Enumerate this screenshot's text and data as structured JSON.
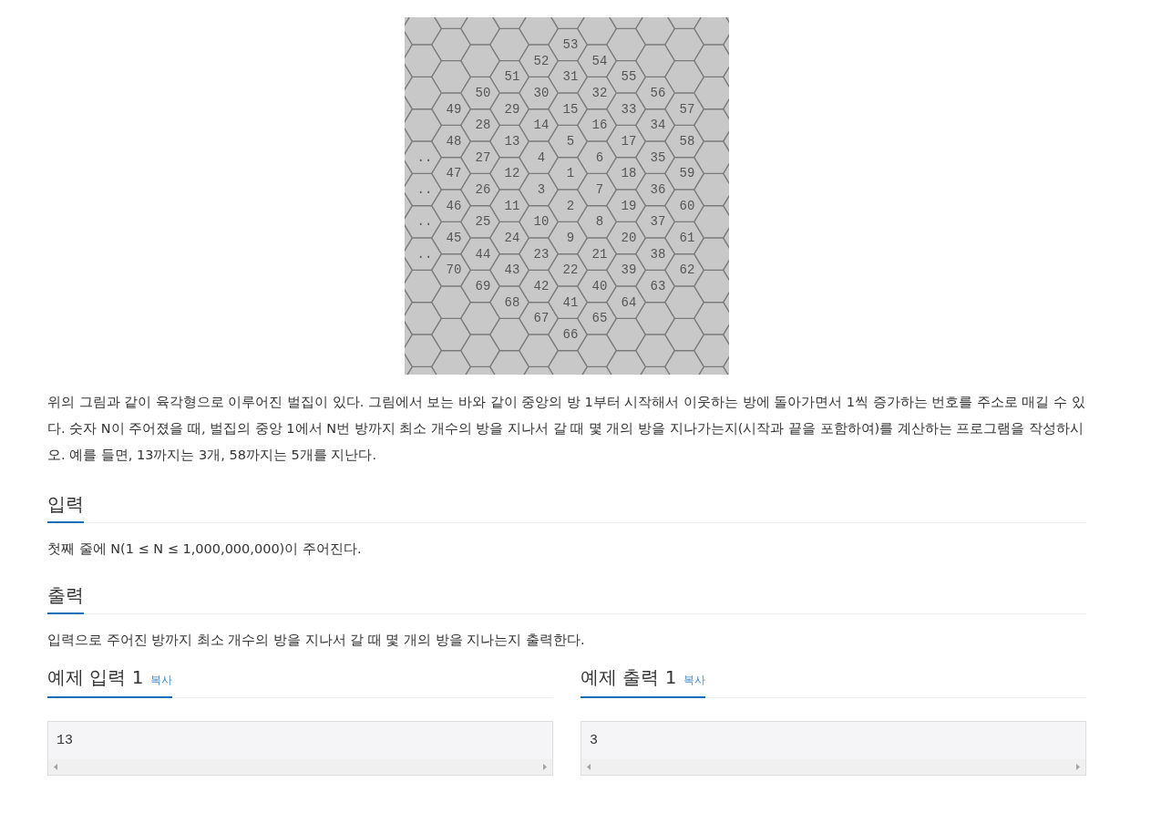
{
  "figure": {
    "rows": [
      [
        "53"
      ],
      [
        "52",
        "54"
      ],
      [
        "51",
        "31",
        "55"
      ],
      [
        "50",
        "30",
        "32",
        "56"
      ],
      [
        "49",
        "29",
        "15",
        "33",
        "57"
      ],
      [
        "28",
        "14",
        "16",
        "34"
      ],
      [
        "48",
        "13",
        "5",
        "17",
        "58"
      ],
      [
        "..",
        "27",
        "4",
        "6",
        "35"
      ],
      [
        "47",
        "12",
        "1",
        "18",
        "59"
      ],
      [
        "..",
        "26",
        "3",
        "7",
        "36"
      ],
      [
        "46",
        "11",
        "2",
        "19",
        "60"
      ],
      [
        "..",
        "25",
        "10",
        "8",
        "37"
      ],
      [
        "45",
        "24",
        "9",
        "20",
        "61"
      ],
      [
        "..",
        "44",
        "23",
        "21",
        "38"
      ],
      [
        "70",
        "43",
        "22",
        "39",
        "62"
      ],
      [
        "69",
        "42",
        "40",
        "63"
      ],
      [
        "68",
        "41",
        "64"
      ],
      [
        "67",
        "65"
      ],
      [
        "66"
      ]
    ]
  },
  "description": "위의 그림과 같이 육각형으로 이루어진 벌집이 있다. 그림에서 보는 바와 같이 중앙의 방 1부터 시작해서 이웃하는 방에 돌아가면서 1씩 증가하는 번호를 주소로 매길 수 있다. 숫자 N이 주어졌을 때, 벌집의 중앙 1에서 N번 방까지 최소 개수의 방을 지나서 갈 때 몇 개의 방을 지나가는지(시작과 끝을 포함하여)를 계산하는 프로그램을 작성하시오. 예를 들면, 13까지는 3개, 58까지는 5개를 지난다.",
  "sections": [
    {
      "heading": "입력",
      "text": "첫째 줄에 N(1 ≤ N ≤ 1,000,000,000)이 주어진다."
    },
    {
      "heading": "출력",
      "text": "입력으로 주어진 방까지 최소 개수의 방을 지나서 갈 때 몇 개의 방을 지나는지 출력한다."
    }
  ],
  "samples": [
    {
      "heading": "예제 입력 1",
      "copy": "복사",
      "content": "13"
    },
    {
      "heading": "예제 출력 1",
      "copy": "복사",
      "content": "3"
    }
  ]
}
